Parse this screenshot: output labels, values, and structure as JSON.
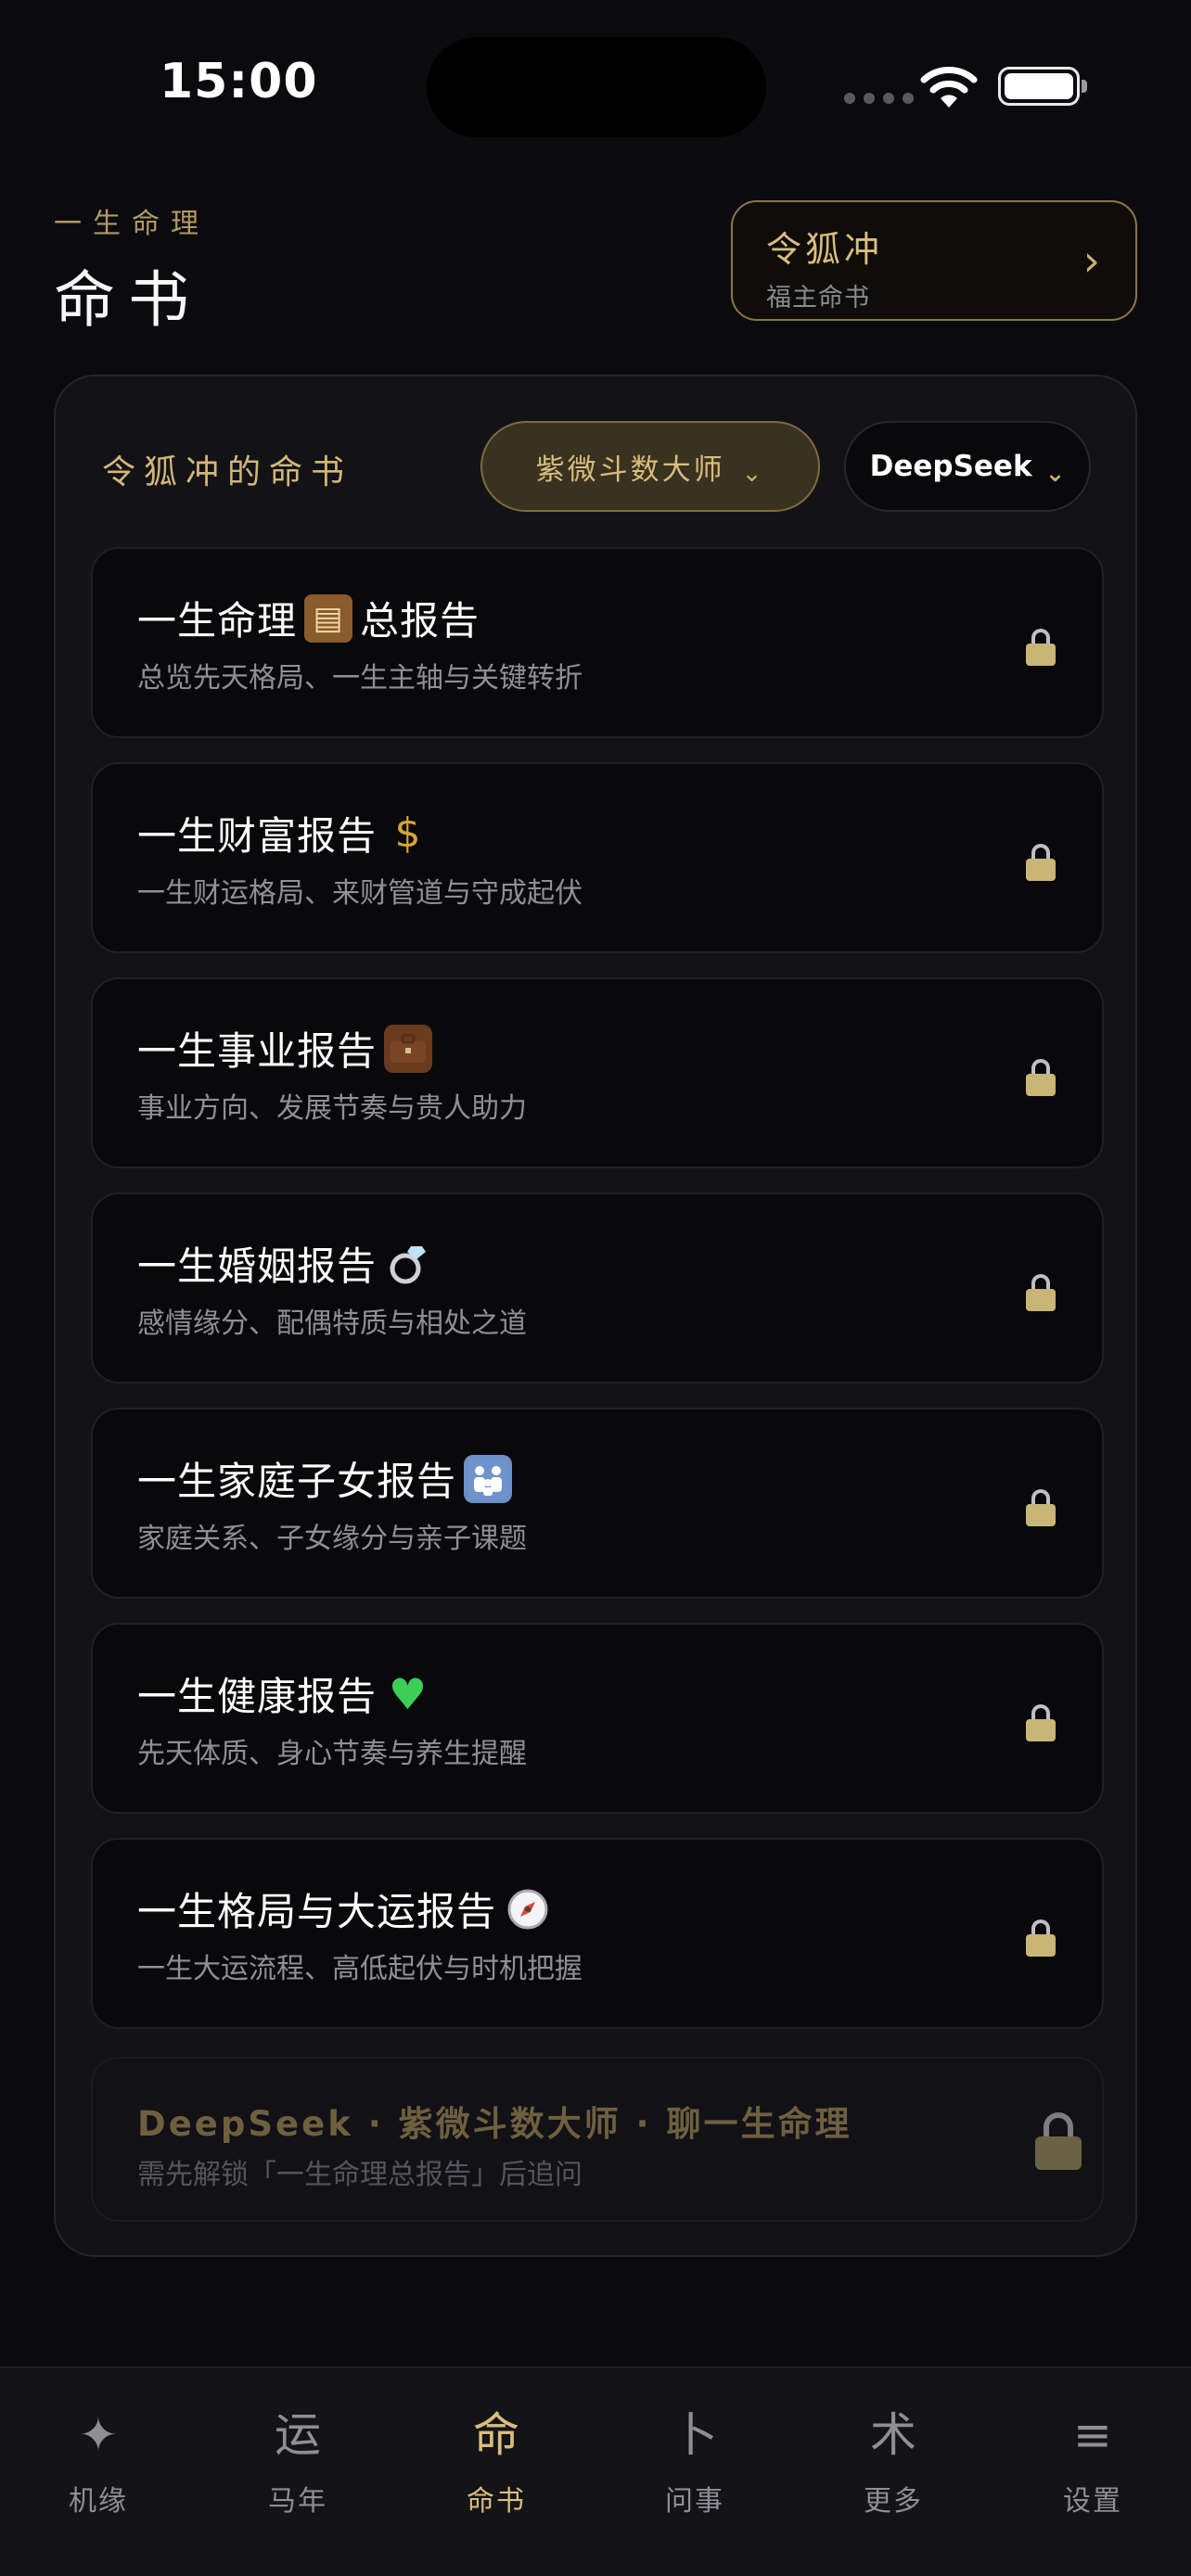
{
  "status": {
    "time": "15:00"
  },
  "header": {
    "subtitle": "一生命理",
    "title": "命书"
  },
  "profile": {
    "name": "令狐冲",
    "subtitle": "福主命书"
  },
  "card": {
    "title": "令狐冲的命书",
    "master_select": "紫微斗数大师",
    "model_select": "DeepSeek"
  },
  "reports": [
    {
      "title_a": "一生命理",
      "title_b": "总报告",
      "icon": "scroll-icon",
      "desc": "总览先天格局、一生主轴与关键转折"
    },
    {
      "title_a": "一生财富报告",
      "title_b": "",
      "icon": "money-bag-icon",
      "desc": "一生财运格局、来财管道与守成起伏"
    },
    {
      "title_a": "一生事业报告",
      "title_b": "",
      "icon": "briefcase-icon",
      "desc": "事业方向、发展节奏与贵人助力"
    },
    {
      "title_a": "一生婚姻报告",
      "title_b": "",
      "icon": "ring-icon",
      "desc": "感情缘分、配偶特质与相处之道"
    },
    {
      "title_a": "一生家庭子女报告",
      "title_b": "",
      "icon": "family-icon",
      "desc": "家庭关系、子女缘分与亲子课题"
    },
    {
      "title_a": "一生健康报告",
      "title_b": "",
      "icon": "green-heart-icon",
      "desc": "先天体质、身心节奏与养生提醒"
    },
    {
      "title_a": "一生格局与大运报告",
      "title_b": "",
      "icon": "compass-icon",
      "desc": "一生大运流程、高低起伏与时机把握"
    }
  ],
  "chat": {
    "title": "DeepSeek · 紫微斗数大师 · 聊一生命理",
    "desc": "需先解锁「一生命理总报告」后追问"
  },
  "tabs": [
    {
      "icon": "✦",
      "label": "机缘"
    },
    {
      "icon": "运",
      "label": "马年"
    },
    {
      "icon": "命",
      "label": "命书",
      "active": true
    },
    {
      "icon": "卜",
      "label": "问事"
    },
    {
      "icon": "术",
      "label": "更多"
    },
    {
      "icon": "≡",
      "label": "设置"
    }
  ],
  "colors": {
    "accent": "#d9bd7c",
    "background": "#0b0b0f",
    "card": "#121217"
  }
}
